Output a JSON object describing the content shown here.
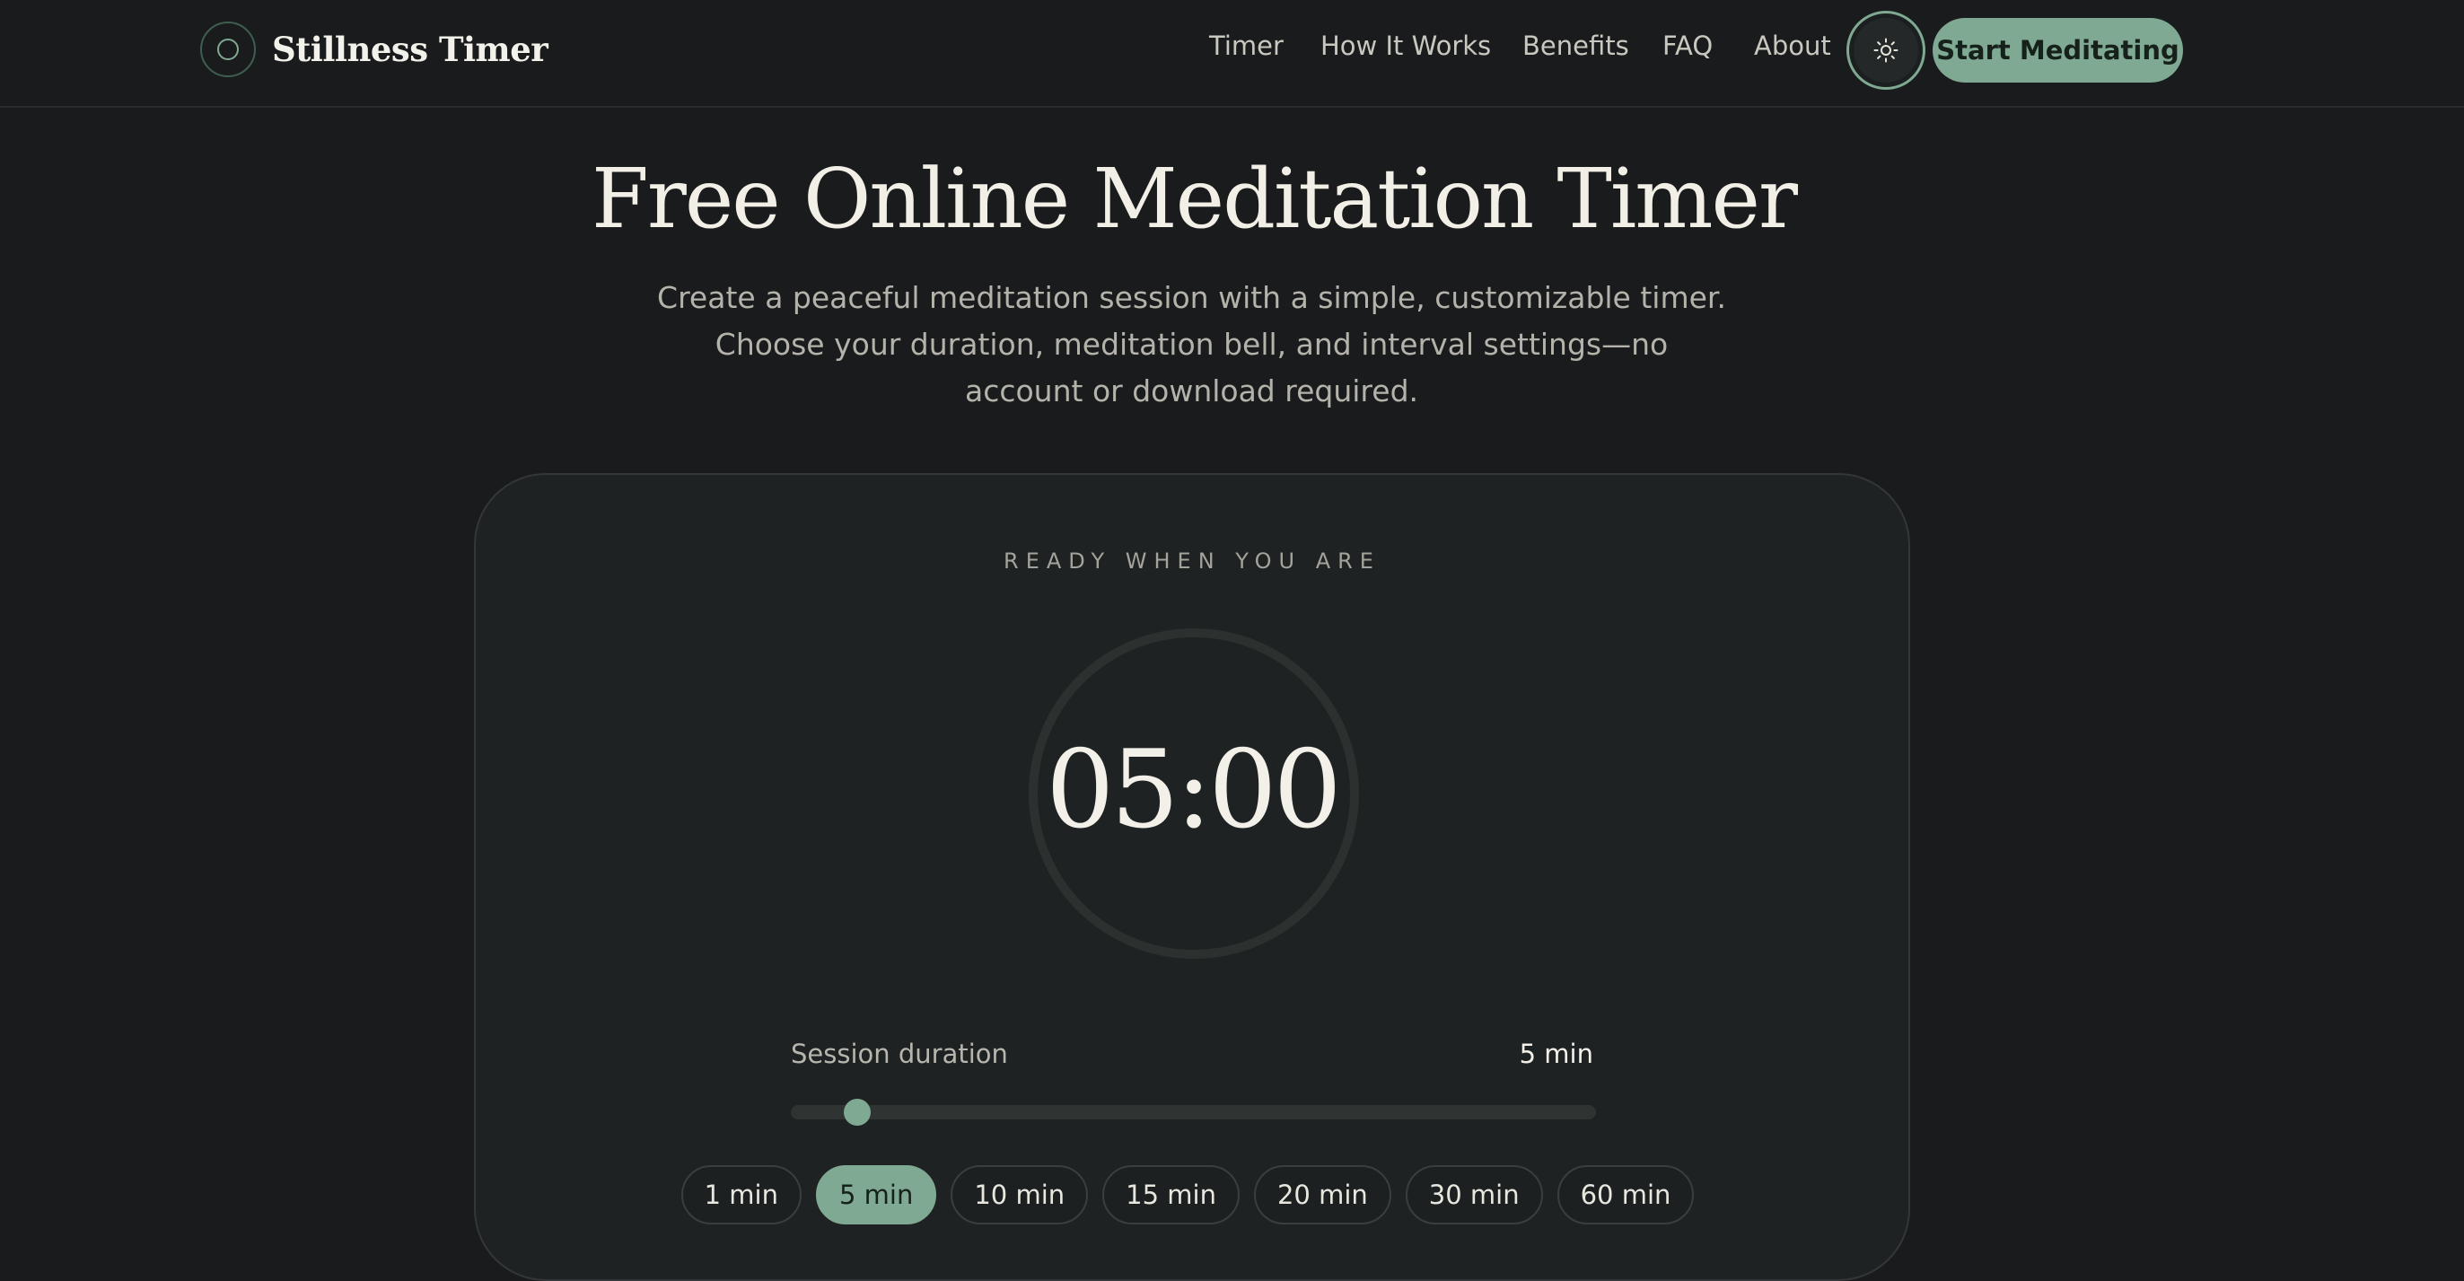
{
  "header": {
    "brand": "Stillness Timer",
    "nav": [
      "Timer",
      "How It Works",
      "Benefits",
      "FAQ",
      "About"
    ],
    "theme_toggle_icon": "sun-icon",
    "cta_label": "Start Meditating"
  },
  "hero": {
    "title": "Free Online Meditation Timer",
    "subtitle": "Create a peaceful meditation session with a simple, customizable timer. Choose your duration, meditation bell, and interval settings—no account or download required."
  },
  "timer": {
    "eyebrow": "READY WHEN YOU ARE",
    "display": "05:00",
    "duration_label": "Session duration",
    "duration_value": "5 min",
    "slider_fraction": 0.083,
    "presets": [
      "1 min",
      "5 min",
      "10 min",
      "15 min",
      "20 min",
      "30 min",
      "60 min"
    ],
    "active_preset": "5 min"
  },
  "colors": {
    "background": "#1a1b1c",
    "accent": "#7fa992",
    "card": "#1f2222"
  }
}
